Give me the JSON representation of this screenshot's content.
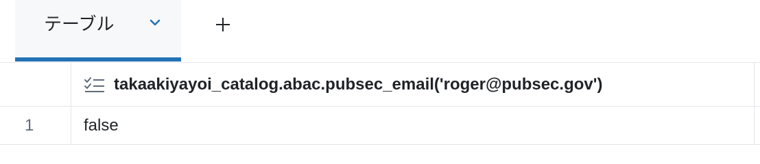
{
  "tabs": {
    "active_label": "テーブル",
    "chevron_icon": "chevron-down-icon",
    "add_icon": "plus-icon"
  },
  "table": {
    "column_type_icon": "boolean-list-icon",
    "columns": [
      "takaakiyayoi_catalog.abac.pubsec_email('roger@pubsec.gov')"
    ],
    "rows": [
      {
        "row_number": "1",
        "values": [
          "false"
        ]
      }
    ]
  },
  "colors": {
    "accent": "#2272b4",
    "border": "#e3e6ea",
    "text": "#1f2328",
    "muted_text": "#5f6b7a"
  }
}
